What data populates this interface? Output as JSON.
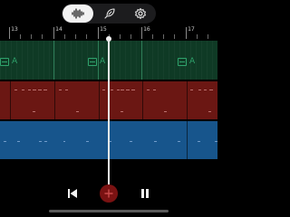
{
  "toolbar": {
    "mode_buttons": [
      {
        "icon": "waveform-icon",
        "selected": true
      },
      {
        "icon": "feather-icon",
        "selected": false
      },
      {
        "icon": "gear-icon",
        "selected": false
      }
    ]
  },
  "ruler": {
    "bars": [
      "13",
      "14",
      "15",
      "16",
      "17"
    ]
  },
  "tracks": [
    {
      "name": "green-track",
      "color": "#0f3a25",
      "clip_label": "A"
    },
    {
      "name": "red-track",
      "color": "#6b1713"
    },
    {
      "name": "blue-track",
      "color": "#17558c"
    }
  ],
  "transport": {
    "back_icon": "skip-back-icon",
    "add_icon": "plus-icon",
    "pause_icon": "pause-icon",
    "accent": "#7a1212"
  }
}
